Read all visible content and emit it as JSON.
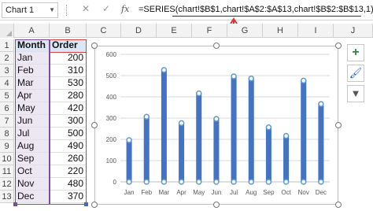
{
  "formula_bar": {
    "name_box": "Chart 1",
    "cancel_glyph": "✕",
    "enter_glyph": "✓",
    "fx_label": "fx",
    "formula": "=SERIES(chart!$B$1,chart!$A$2:$A$13,chart!$B$2:$B$13,1)"
  },
  "columns": [
    "A",
    "B",
    "C",
    "D",
    "E",
    "F",
    "G",
    "H",
    "I",
    "J"
  ],
  "rows": [
    "1",
    "2",
    "3",
    "4",
    "5",
    "6",
    "7",
    "8",
    "9",
    "10",
    "11",
    "12",
    "13"
  ],
  "table": {
    "headers": [
      "Month",
      "Order"
    ],
    "rows": [
      {
        "month": "Jan",
        "order": "200"
      },
      {
        "month": "Feb",
        "order": "310"
      },
      {
        "month": "Mar",
        "order": "530"
      },
      {
        "month": "Apr",
        "order": "280"
      },
      {
        "month": "May",
        "order": "420"
      },
      {
        "month": "Jun",
        "order": "300"
      },
      {
        "month": "Jul",
        "order": "500"
      },
      {
        "month": "Aug",
        "order": "490"
      },
      {
        "month": "Sep",
        "order": "260"
      },
      {
        "month": "Oct",
        "order": "220"
      },
      {
        "month": "Nov",
        "order": "480"
      },
      {
        "month": "Dec",
        "order": "370"
      }
    ]
  },
  "chart_data": {
    "type": "bar",
    "categories": [
      "Jan",
      "Feb",
      "Mar",
      "Apr",
      "May",
      "Jun",
      "Jul",
      "Aug",
      "Sep",
      "Oct",
      "Nov",
      "Dec"
    ],
    "values": [
      200,
      310,
      530,
      280,
      420,
      300,
      500,
      490,
      260,
      220,
      480,
      370
    ],
    "ylim": [
      0,
      600
    ],
    "yticks": [
      "0",
      "100",
      "200",
      "300",
      "400",
      "500",
      "600"
    ],
    "grid": true,
    "bar_color": "#4472c4",
    "marker_color": "#5b9bd5",
    "selected": true
  },
  "chart_tools": {
    "elements_icon": "plus-icon",
    "styles_icon": "brush-icon",
    "filters_icon": "filter-icon",
    "plus_glyph": "+",
    "brush_glyph": "🖌",
    "filter_glyph": "▼"
  },
  "colors": {
    "formula_arrow": "#e03030",
    "range_purple": "#7a4aa0",
    "range_blue": "#3a6fc4",
    "range_red": "#d24040"
  }
}
